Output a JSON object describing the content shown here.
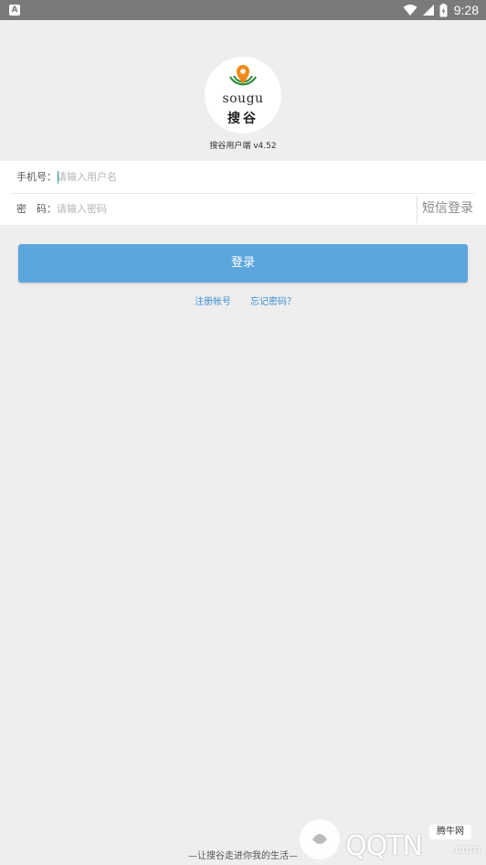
{
  "status_bar": {
    "notification_icon": "A",
    "time": "9:28"
  },
  "logo": {
    "english": "sougu",
    "chinese": "搜谷"
  },
  "app_version": "搜谷用户端 v4.52",
  "form": {
    "phone_label": "手机号：",
    "phone_placeholder": "请输入用户名",
    "password_label": "密　码：",
    "password_placeholder": "请输入密码",
    "sms_login": "短信登录"
  },
  "login_button": "登录",
  "links": {
    "register": "注册帐号",
    "forgot": "忘记密码？"
  },
  "slogan": "—让搜谷走进你我的生活—",
  "watermark": {
    "site_label": "腾牛网",
    "brand": "QQTN",
    "suffix": ".com"
  },
  "colors": {
    "primary_button": "#5ba6dd",
    "link": "#3f8fcf",
    "background": "#eeeeee",
    "status_bar": "#7a7a7a"
  }
}
